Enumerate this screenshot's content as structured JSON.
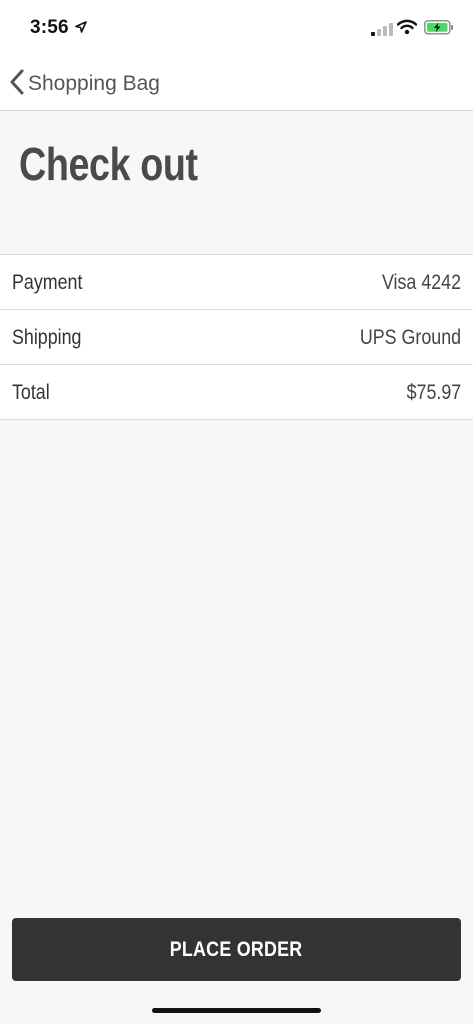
{
  "status_bar": {
    "time": "3:56",
    "icons": [
      "location-arrow-icon",
      "cellular-signal-icon",
      "wifi-icon",
      "battery-charging-icon"
    ],
    "battery_color": "#4cd964"
  },
  "nav": {
    "back_label": "Shopping Bag",
    "back_icon": "chevron-left-icon"
  },
  "page": {
    "title": "Check out"
  },
  "summary": {
    "rows": [
      {
        "label": "Payment",
        "value": "Visa 4242"
      },
      {
        "label": "Shipping",
        "value": "UPS Ground"
      },
      {
        "label": "Total",
        "value": "$75.97"
      }
    ]
  },
  "actions": {
    "place_order_label": "PLACE ORDER",
    "button_color": "#333333"
  }
}
